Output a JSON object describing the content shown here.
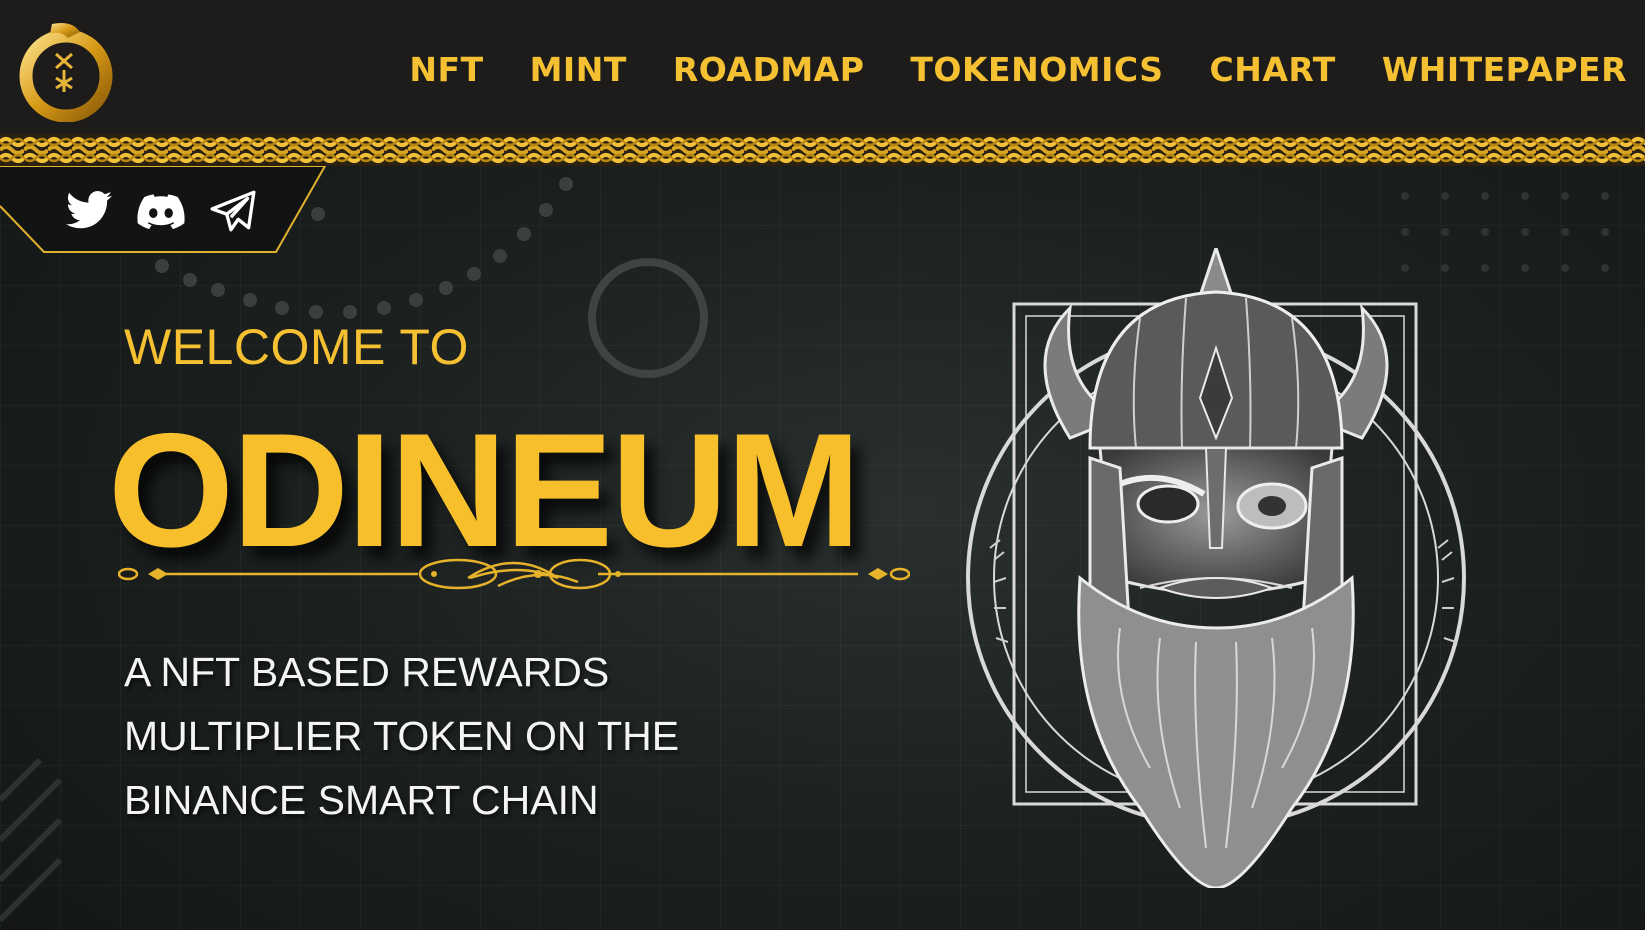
{
  "header": {
    "nav": [
      {
        "label": "NFT"
      },
      {
        "label": "MINT"
      },
      {
        "label": "ROADMAP"
      },
      {
        "label": "TOKENOMICS"
      },
      {
        "label": "CHART"
      },
      {
        "label": "WHITEPAPER"
      }
    ]
  },
  "social": {
    "icons": [
      "twitter-icon",
      "discord-icon",
      "telegram-icon"
    ]
  },
  "hero": {
    "welcome": "WELCOME TO",
    "brand": "ODINEUM",
    "tagline_lines": [
      "A NFT BASED REWARDS",
      "MULTIPLIER TOKEN ON THE",
      "BINANCE SMART CHAIN"
    ]
  },
  "colors": {
    "accent": "#f5c031",
    "header_bg": "#1e1c1a",
    "page_bg": "#1c2120",
    "text": "#f4f4f4"
  }
}
